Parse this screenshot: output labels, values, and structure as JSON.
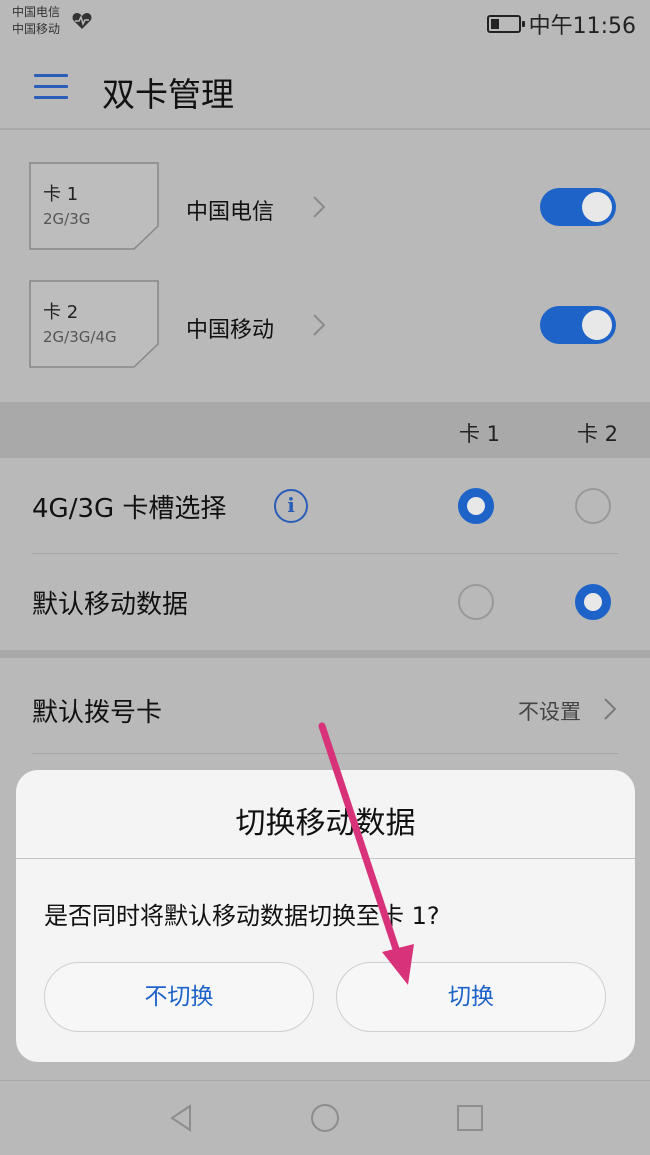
{
  "status": {
    "carrier1": "中国电信",
    "carrier2": "中国移动",
    "time": "中午11:56"
  },
  "header": {
    "title": "双卡管理"
  },
  "sims": [
    {
      "name": "卡 1",
      "type": "2G/3G",
      "carrier": "中国电信",
      "enabled": true
    },
    {
      "name": "卡 2",
      "type": "2G/3G/4G",
      "carrier": "中国移动",
      "enabled": true
    }
  ],
  "columns": {
    "card1": "卡 1",
    "card2": "卡 2"
  },
  "settings": [
    {
      "label": "4G/3G 卡槽选择",
      "selected": "card1"
    },
    {
      "label": "默认移动数据",
      "selected": "card2"
    }
  ],
  "dial": {
    "label": "默认拨号卡",
    "value": "不设置"
  },
  "dialog": {
    "title": "切换移动数据",
    "message": "是否同时将默认移动数据切换至卡 1?",
    "cancel_label": "不切换",
    "confirm_label": "切换"
  },
  "colors": {
    "accent": "#1e63c8",
    "annotation_arrow": "#d8337a"
  }
}
